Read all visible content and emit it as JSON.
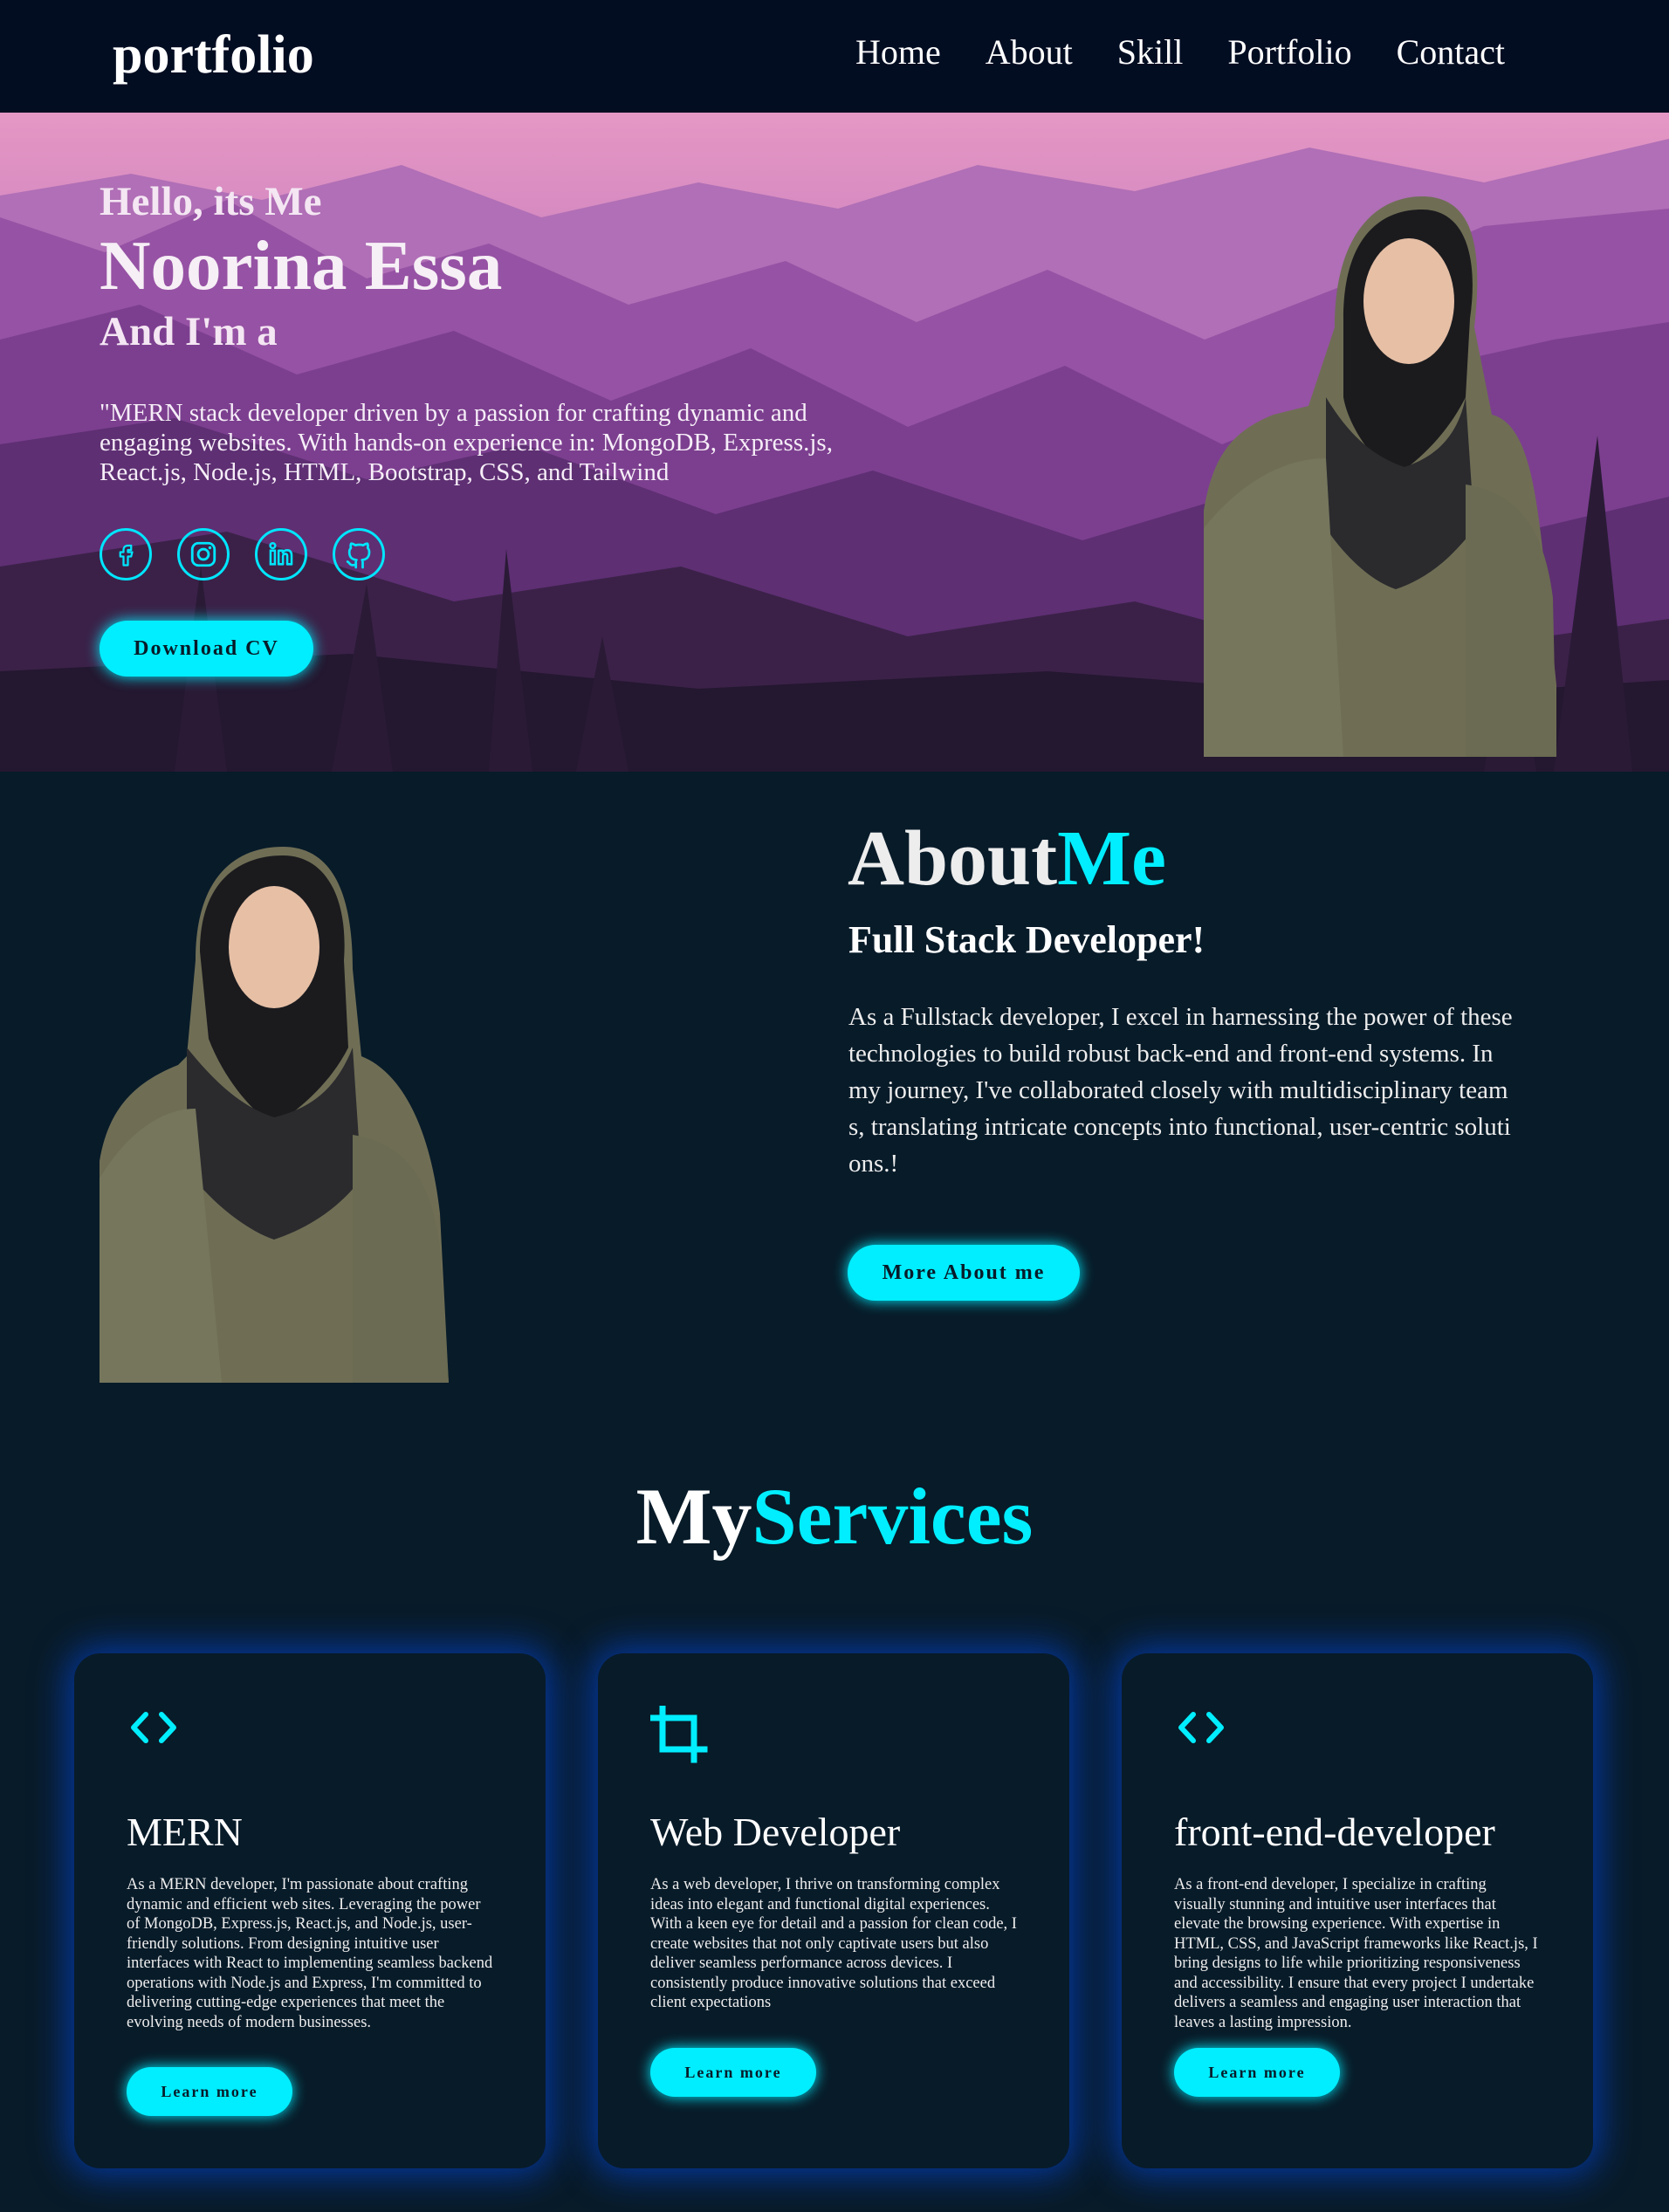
{
  "nav": {
    "logo": "portfolio",
    "links": [
      "Home",
      "About",
      "Skill",
      "Portfolio",
      "Contact"
    ]
  },
  "hero": {
    "greeting": "Hello, its Me",
    "name": "Noorina Essa",
    "role_prefix": "And I'm a",
    "description": "\"MERN stack developer driven by a passion for crafting dynamic and engaging websites. With hands-on experience in: MongoDB, Express.js, React.js, Node.js, HTML, Bootstrap, CSS, and Tailwind",
    "socials": [
      "facebook-icon",
      "instagram-icon",
      "linkedin-icon",
      "github-icon"
    ],
    "cv_button": "Download CV"
  },
  "about": {
    "title_main": "About",
    "title_accent": "Me",
    "subtitle": "Full Stack Developer!",
    "description": "As a Fullstack developer, I excel in harnessing the power of these technologies to build robust back-end and front-end systems. In my journey, I've collaborated closely with multidisciplinary teams, translating intricate concepts into functional, user-centric solutions.!",
    "button": "More About me"
  },
  "services": {
    "title_main": "My",
    "title_accent": "Services",
    "cards": [
      {
        "icon": "code-icon",
        "title": "MERN",
        "text": "As a MERN developer, I'm passionate about crafting dynamic and efficient web sites. Leveraging the power of MongoDB, Express.js, React.js, and Node.js, user-friendly solutions. From designing intuitive user interfaces with React to implementing seamless backend operations with Node.js and Express, I'm committed to delivering cutting-edge experiences that meet the evolving needs of modern businesses.",
        "button": "Learn more"
      },
      {
        "icon": "crop-icon",
        "title": "Web Developer",
        "text": "As a web developer, I thrive on transforming complex ideas into elegant and functional digital experiences. With a keen eye for detail and a passion for clean code, I create websites that not only captivate users but also deliver seamless performance across devices. I consistently produce innovative solutions that exceed client expectations",
        "button": "Learn more"
      },
      {
        "icon": "code-icon",
        "title": "front-end-developer",
        "text": "As a front-end developer, I specialize in crafting visually stunning and intuitive user interfaces that elevate the browsing experience. With expertise in HTML, CSS, and JavaScript frameworks like React.js, I bring designs to life while prioritizing responsiveness and accessibility. I ensure that every project I undertake delivers a seamless and engaging user interaction that leaves a lasting impression.",
        "button": "Learn more"
      }
    ]
  },
  "colors": {
    "accent": "#00eeff",
    "background": "#081b29",
    "nav": "#030d22"
  }
}
